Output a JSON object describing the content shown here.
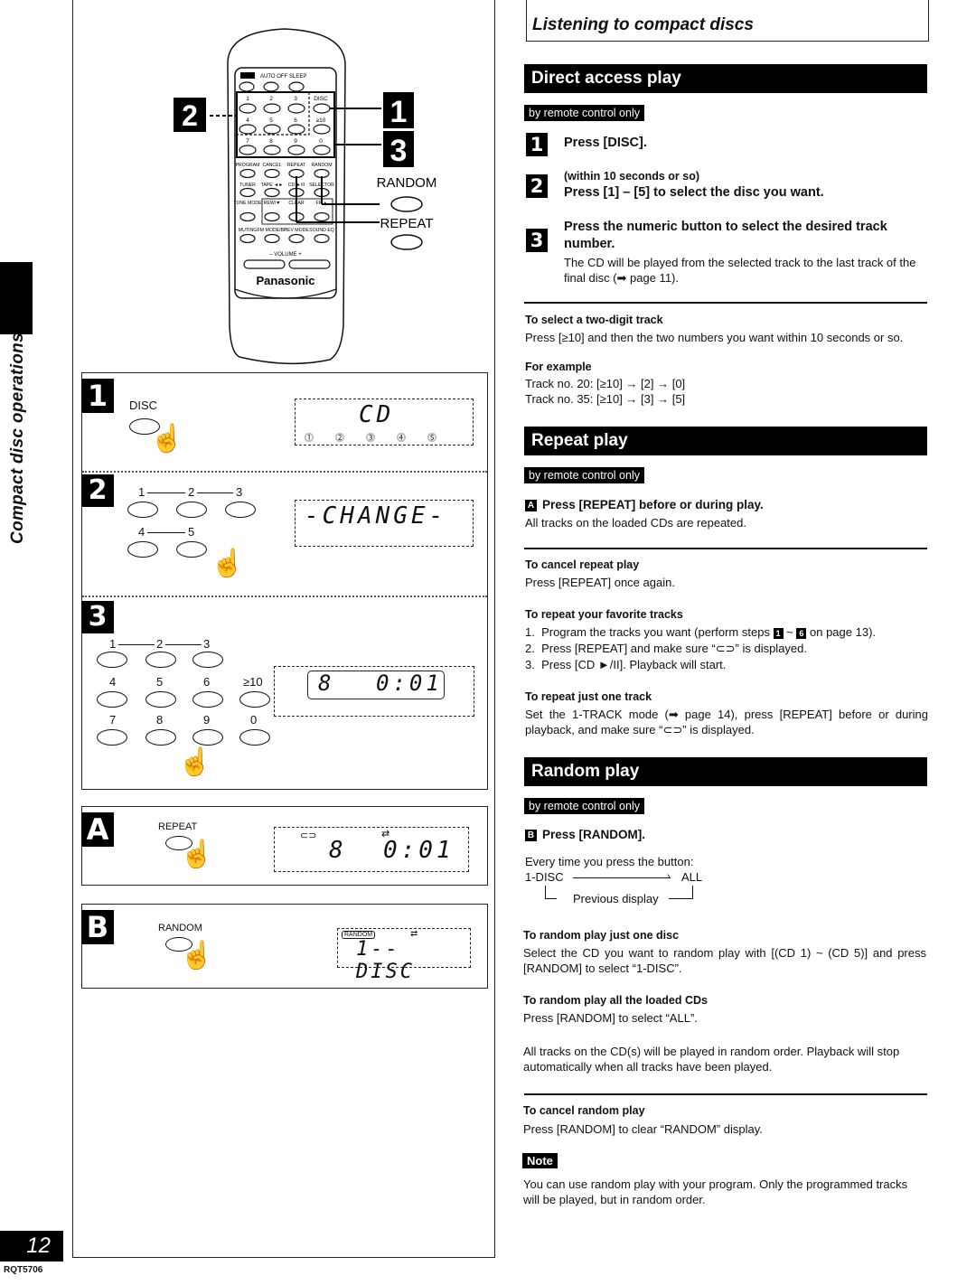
{
  "page": {
    "side_label": "Compact disc operations",
    "page_number": "12",
    "doc_code": "RQT5706",
    "title": "Listening to compact discs"
  },
  "remote": {
    "brand": "Panasonic",
    "top_buttons": [
      "AUTO OFF",
      "SLEEP"
    ],
    "number_row_labels": [
      [
        "1",
        "2",
        "3",
        "DISC"
      ],
      [
        "4",
        "5",
        "6",
        "≥10"
      ],
      [
        "7",
        "8",
        "9",
        "0"
      ]
    ],
    "function_rows": [
      [
        "PROGRAM",
        "CANCEL",
        "REPEAT",
        "RANDOM"
      ],
      [
        "TUNER",
        "TAPE ◄►",
        "CD ►/II",
        "SELECTOR"
      ],
      [
        "TUNE MODE",
        "REW/▼",
        "CLEAR",
        "FF/▲"
      ],
      [
        "MUTING",
        "FM MODE/BP",
        "REV MODE",
        "SOUND EQ"
      ]
    ],
    "volume_label": "–  VOLUME  +",
    "callouts": {
      "step1": "1",
      "step2": "2",
      "step3": "3",
      "random": "RANDOM",
      "repeat": "REPEAT"
    }
  },
  "steps_diagram": {
    "step1": {
      "badge": "1",
      "button": "DISC",
      "display": "CD",
      "discs": [
        "1",
        "2",
        "3",
        "4",
        "5"
      ]
    },
    "step2": {
      "badge": "2",
      "keys": [
        "1",
        "2",
        "3",
        "4",
        "5"
      ],
      "display": "-CHANGE-",
      "selected_disc": "2"
    },
    "step3": {
      "badge": "3",
      "keys": [
        "1",
        "2",
        "3",
        "4",
        "5",
        "6",
        "≥10",
        "7",
        "8",
        "9",
        "0"
      ],
      "display_track": "8",
      "display_time": "0:01"
    },
    "stepA": {
      "badge": "A",
      "button": "REPEAT",
      "display_track": "8",
      "display_time": "0:01"
    },
    "stepB": {
      "badge": "B",
      "button": "RANDOM",
      "indicator": "RANDOM",
      "display": "1-- DISC"
    }
  },
  "direct_access": {
    "heading": "Direct access play",
    "tag": "by remote control only",
    "steps": [
      {
        "num": "1",
        "sub": "",
        "text": "Press [DISC]."
      },
      {
        "num": "2",
        "sub": "(within 10 seconds or so)",
        "text": "Press [1] – [5] to select the disc you want."
      },
      {
        "num": "3",
        "sub": "",
        "text": "Press the numeric button to select the desired track number.",
        "detail": "The CD will be played from the selected track to the last track of the final disc (➡ page 11)."
      }
    ],
    "two_digit": {
      "heading": "To select a two-digit track",
      "body": "Press [≥10] and then the two numbers you want within 10 seconds or so.",
      "example_heading": "For example",
      "examples": [
        "Track no. 20: [≥10] → [2] → [0]",
        "Track no. 35: [≥10] → [3] → [5]"
      ]
    }
  },
  "repeat": {
    "heading": "Repeat play",
    "tag": "by remote control only",
    "step_badge": "A",
    "step_text": "Press [REPEAT] before or during play.",
    "step_detail": "All tracks on the loaded CDs are repeated.",
    "cancel_heading": "To cancel repeat play",
    "cancel_body": "Press [REPEAT] once again.",
    "favorite_heading": "To repeat your favorite tracks",
    "favorite_items": [
      {
        "n": "1.",
        "pre": "Program the tracks you want (perform steps ",
        "b1": "1",
        "mid": " ~ ",
        "b2": "6",
        "post": " on page 13)."
      },
      {
        "n": "2.",
        "text": "Press [REPEAT] and make sure “⊂⊃” is displayed."
      },
      {
        "n": "3.",
        "text": "Press [CD ►/II]. Playback will start."
      }
    ],
    "one_track_heading": "To repeat just one track",
    "one_track_body": "Set the 1-TRACK mode (➡ page 14), press [REPEAT] before or during playback, and make sure “⊂⊃” is displayed."
  },
  "random": {
    "heading": "Random play",
    "tag": "by remote control only",
    "step_badge": "B",
    "step_text": "Press [RANDOM].",
    "cycle_intro": "Every time you press the button:",
    "cycle_from": "1-DISC",
    "cycle_to": "ALL",
    "cycle_back": "Previous display",
    "one_disc_heading": "To random play just one disc",
    "one_disc_body": "Select the CD you want to random play with [(CD 1) ~ (CD 5)] and press [RANDOM] to select “1-DISC”.",
    "all_heading": "To random play all the loaded CDs",
    "all_body": "Press [RANDOM] to select “ALL”.",
    "all_detail": "All tracks on the CD(s) will be played in random order. Playback will stop automatically when all tracks have been played.",
    "cancel_heading": "To cancel random play",
    "cancel_body": "Press [RANDOM] to clear “RANDOM” display."
  },
  "note": {
    "label": "Note",
    "body": "You can use random play with your program. Only the programmed tracks will be played, but in random order."
  }
}
